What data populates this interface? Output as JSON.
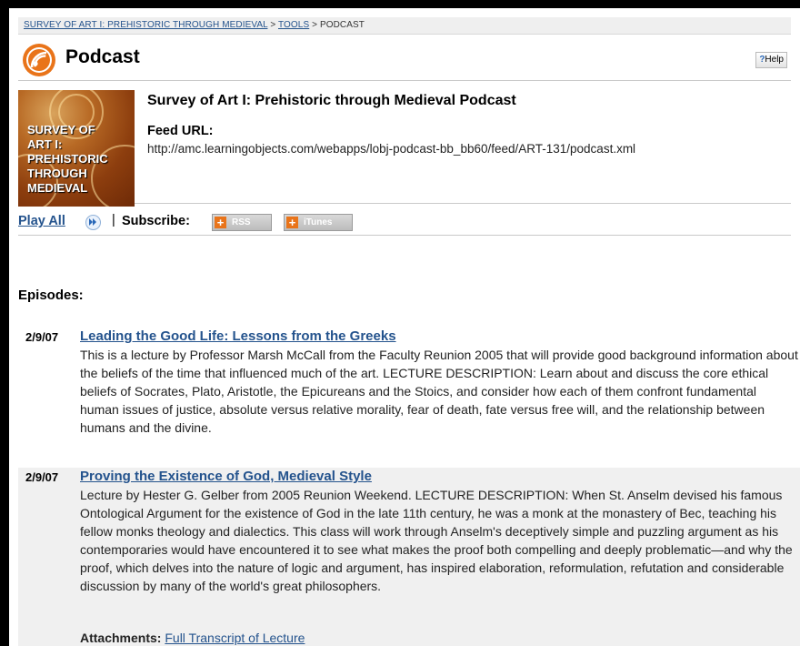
{
  "breadcrumb": {
    "items": [
      "SURVEY OF ART I: PREHISTORIC THROUGH MEDIEVAL",
      "TOOLS",
      "PODCAST"
    ],
    "separator": ">"
  },
  "header": {
    "title": "Podcast",
    "help_label": "Help",
    "help_icon": "?"
  },
  "feed": {
    "cover_text": "SURVEY OF\nART I:\nPREHISTORIC\nTHROUGH\nMEDIEVAL",
    "title": "Survey of Art I: Prehistoric through Medieval Podcast",
    "url_label": "Feed URL:",
    "url": "http://amc.learningobjects.com/webapps/lobj-podcast-bb_bb60/feed/ART-131/podcast.xml"
  },
  "actions": {
    "play_all": "Play All",
    "separator": "|",
    "subscribe_label": "Subscribe:",
    "rss_label": "RSS",
    "itunes_label": "iTunes"
  },
  "episodes_label": "Episodes:",
  "episodes": [
    {
      "date": "2/9/07",
      "title": "Leading the Good Life: Lessons from the Greeks",
      "description": "This is a lecture by Professor Marsh McCall from the Faculty Reunion 2005 that will provide good background information about the beliefs of the time that influenced much of the art. LECTURE DESCRIPTION: Learn about and discuss the core ethical beliefs of Socrates, Plato, Aristotle, the Epicureans and the Stoics, and consider how each of them confront fundamental human issues of justice, absolute versus relative morality, fear of death, fate versus free will, and the relationship between humans and the divine."
    },
    {
      "date": "2/9/07",
      "title": "Proving the Existence of God, Medieval Style",
      "description": "Lecture by Hester G. Gelber from 2005 Reunion Weekend. LECTURE DESCRIPTION: When St. Anselm devised his famous Ontological Argument for the existence of God in the late 11th century, he was a monk at the monastery of Bec, teaching his fellow monks theology and dialectics. This class will work through Anselm's deceptively simple and puzzling argument as his contemporaries would have encountered it to see what makes the proof both compelling and deeply problematic—and why the proof, which delves into the nature of logic and argument, has inspired elaboration, reformulation, refutation and considerable discussion by many of the world's great philosophers.",
      "attachments_label": "Attachments:",
      "attachment": "Full Transcript of Lecture"
    }
  ],
  "colors": {
    "link": "#24538d",
    "accent": "#e9741a",
    "episode_alt_bg": "#f0f0f0"
  }
}
